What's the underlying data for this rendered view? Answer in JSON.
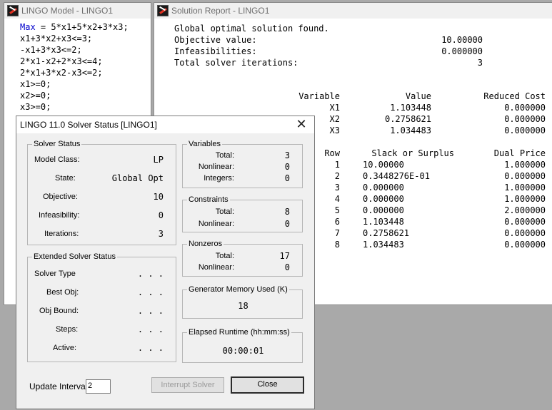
{
  "model_window": {
    "title": "LINGO Model - LINGO1",
    "keyword": "Max",
    "first_line_rest": " = 5*x1+5*x2+3*x3;",
    "lines": [
      "x1+3*x2+x3<=3;",
      "-x1+3*x3<=2;",
      "2*x1-x2+2*x3<=4;",
      "2*x1+3*x2-x3<=2;",
      "x1>=0;",
      "x2>=0;",
      "x3>=0;"
    ]
  },
  "report_window": {
    "title": "Solution Report - LINGO1",
    "header_line": "Global optimal solution found.",
    "summary": [
      {
        "label": "Objective value:",
        "value": "10.00000"
      },
      {
        "label": "Infeasibilities:",
        "value": "0.000000"
      },
      {
        "label": "Total solver iterations:",
        "value": "3"
      }
    ],
    "variables_header": {
      "col1": "Variable",
      "col2": "Value",
      "col3": "Reduced Cost"
    },
    "variables": [
      {
        "name": "X1",
        "value": "1.103448",
        "reduced_cost": "0.000000"
      },
      {
        "name": "X2",
        "value": "0.2758621",
        "reduced_cost": "0.000000"
      },
      {
        "name": "X3",
        "value": "1.034483",
        "reduced_cost": "0.000000"
      }
    ],
    "rows_header": {
      "col1": "Row",
      "col2": "Slack or Surplus",
      "col3": "Dual Price"
    },
    "rows": [
      {
        "row": "1",
        "slack": "10.00000",
        "dual": "1.000000"
      },
      {
        "row": "2",
        "slack": "0.3448276E-01",
        "dual": "0.000000"
      },
      {
        "row": "3",
        "slack": "0.000000",
        "dual": "1.000000"
      },
      {
        "row": "4",
        "slack": "0.000000",
        "dual": "1.000000"
      },
      {
        "row": "5",
        "slack": "0.000000",
        "dual": "2.000000"
      },
      {
        "row": "6",
        "slack": "1.103448",
        "dual": "0.000000"
      },
      {
        "row": "7",
        "slack": "0.2758621",
        "dual": "0.000000"
      },
      {
        "row": "8",
        "slack": "1.034483",
        "dual": "0.000000"
      }
    ]
  },
  "status_dialog": {
    "title": "LINGO 11.0 Solver Status [LINGO1]",
    "close_glyph": "✕",
    "solver_status": {
      "legend": "Solver Status",
      "model_class_label": "Model Class:",
      "model_class": "LP",
      "state_label": "State:",
      "state": "Global Opt",
      "objective_label": "Objective:",
      "objective": "10",
      "infeasibility_label": "Infeasibility:",
      "infeasibility": "0",
      "iterations_label": "Iterations:",
      "iterations": "3"
    },
    "extended": {
      "legend": "Extended Solver Status",
      "solver_type_label": "Solver Type",
      "solver_type": ". . .",
      "best_obj_label": "Best Obj:",
      "best_obj": ". . .",
      "obj_bound_label": "Obj Bound:",
      "obj_bound": ". . .",
      "steps_label": "Steps:",
      "steps": ". . .",
      "active_label": "Active:",
      "active": ". . ."
    },
    "variables": {
      "legend": "Variables",
      "total_label": "Total:",
      "total": "3",
      "nonlinear_label": "Nonlinear:",
      "nonlinear": "0",
      "integers_label": "Integers:",
      "integers": "0"
    },
    "constraints": {
      "legend": "Constraints",
      "total_label": "Total:",
      "total": "8",
      "nonlinear_label": "Nonlinear:",
      "nonlinear": "0"
    },
    "nonzeros": {
      "legend": "Nonzeros",
      "total_label": "Total:",
      "total": "17",
      "nonlinear_label": "Nonlinear:",
      "nonlinear": "0"
    },
    "memory": {
      "legend": "Generator Memory Used (K)",
      "value": "18"
    },
    "runtime": {
      "legend": "Elapsed Runtime (hh:mm:ss)",
      "value": "00:00:01"
    },
    "update_interval_label": "Update Interval:",
    "update_interval_value": "2",
    "interrupt_button": "Interrupt Solver",
    "close_button": "Close"
  }
}
